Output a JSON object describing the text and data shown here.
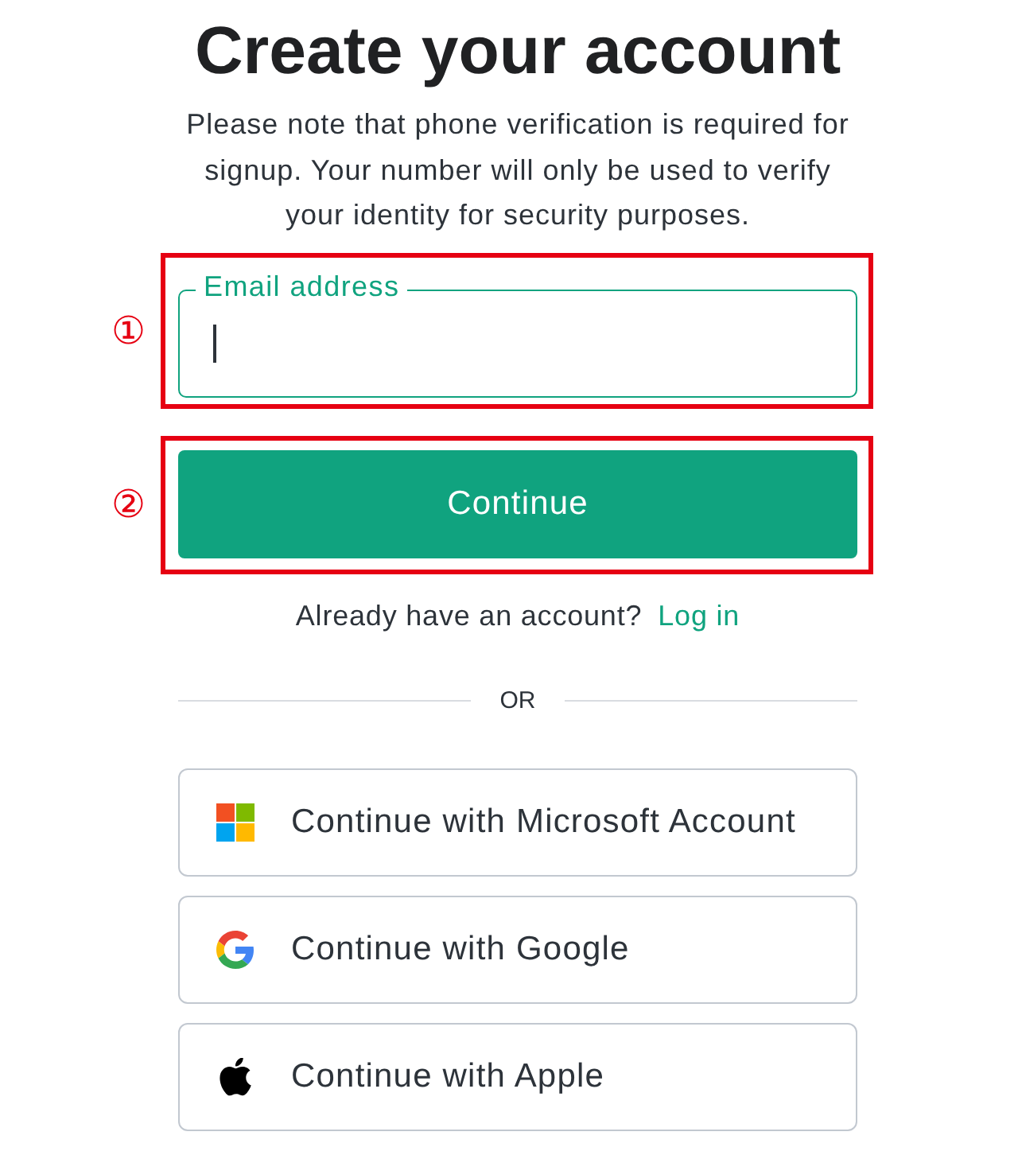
{
  "heading": "Create your account",
  "notice": "Please note that phone verification is required for signup. Your number will only be used to verify your identity for security purposes.",
  "email_field": {
    "label": "Email address",
    "focused": true,
    "callout": "①"
  },
  "continue_button": {
    "label": "Continue",
    "callout": "②"
  },
  "login_prompt": {
    "text": "Already have an account?",
    "link": "Log in"
  },
  "divider": "OR",
  "social_buttons": [
    {
      "kind": "microsoft",
      "label": "Continue with Microsoft Account"
    },
    {
      "kind": "google",
      "label": "Continue with Google"
    },
    {
      "kind": "apple",
      "label": "Continue with Apple"
    }
  ]
}
